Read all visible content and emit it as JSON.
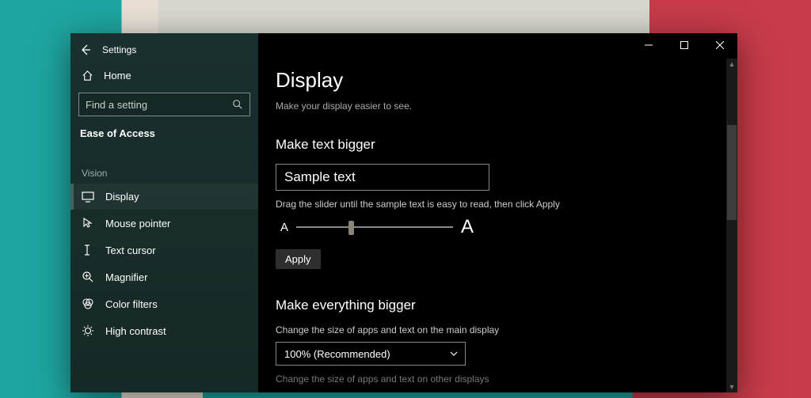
{
  "window": {
    "app_name": "Settings"
  },
  "sidebar": {
    "home_label": "Home",
    "search_placeholder": "Find a setting",
    "category_label": "Ease of Access",
    "group_label": "Vision",
    "items": [
      {
        "label": "Display"
      },
      {
        "label": "Mouse pointer"
      },
      {
        "label": "Text cursor"
      },
      {
        "label": "Magnifier"
      },
      {
        "label": "Color filters"
      },
      {
        "label": "High contrast"
      }
    ]
  },
  "main": {
    "title": "Display",
    "subtitle": "Make your display easier to see.",
    "section1": {
      "heading": "Make text bigger",
      "sample_text": "Sample text",
      "instruction": "Drag the slider until the sample text is easy to read, then click Apply",
      "letter_small": "A",
      "letter_big": "A",
      "apply_label": "Apply"
    },
    "section2": {
      "heading": "Make everything bigger",
      "desc": "Change the size of apps and text on the main display",
      "dropdown_value": "100% (Recommended)",
      "other_displays": "Change the size of apps and text on other displays"
    }
  }
}
